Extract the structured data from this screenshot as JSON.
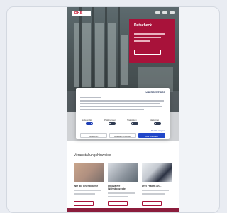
{
  "site": {
    "logo_text": "DKB"
  },
  "promo": {
    "title": "Datacheck"
  },
  "section": {
    "title": "Veranstaltungshinweise"
  },
  "cards": [
    {
      "title": "Wie die Energiekrise"
    },
    {
      "title": "Innovative Wohnkonzepte"
    },
    {
      "title": "Drei Fragen an..."
    }
  ],
  "consent": {
    "brand": "USERCENTRICS",
    "categories": [
      "Notwendig",
      "Präferenzen",
      "Statistiken",
      "Marketing"
    ],
    "details_link": "Details zeigen",
    "buttons": {
      "deny": "Ablehnen",
      "select": "Auswahl erlauben",
      "accept": "Alle erlauben"
    }
  },
  "colors": {
    "brand_red": "#a8123a",
    "consent_blue": "#2147c9"
  }
}
